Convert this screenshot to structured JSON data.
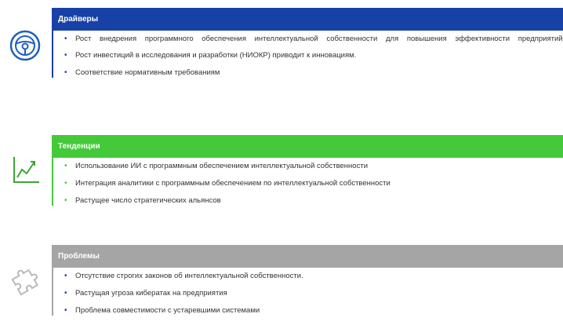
{
  "colors": {
    "drivers": "#1741a6",
    "trends": "#44c93a",
    "problems": "#a5a5a5",
    "drivers_icon": "#1f5fbf",
    "trends_icon": "#3aa832",
    "problems_icon": "#b5b5b5"
  },
  "sections": [
    {
      "title": "Драйверы",
      "icon": "steering-wheel-icon",
      "items": [
        "Рост внедрения программного обеспечения интеллектуальной собственности для повышения эффективности предприятий",
        "Рост инвестиций в исследования и разработки (НИОКР) приводит к инновациям.",
        "Соответствие нормативным требованиям"
      ]
    },
    {
      "title": "Тенденции",
      "icon": "trend-chart-icon",
      "items": [
        "Использование ИИ с программным обеспечением интеллектуальной собственности",
        "Интеграция аналитики с программным обеспечением по интеллектуальной собственности",
        "Растущее число стратегических альянсов"
      ]
    },
    {
      "title": "Проблемы",
      "icon": "puzzle-icon",
      "items": [
        "Отсутствие строгих законов об интеллектуальной собственности.",
        "Растущая угроза кибератак на предприятия",
        "Проблема совместимости с устаревшими системами"
      ]
    }
  ]
}
